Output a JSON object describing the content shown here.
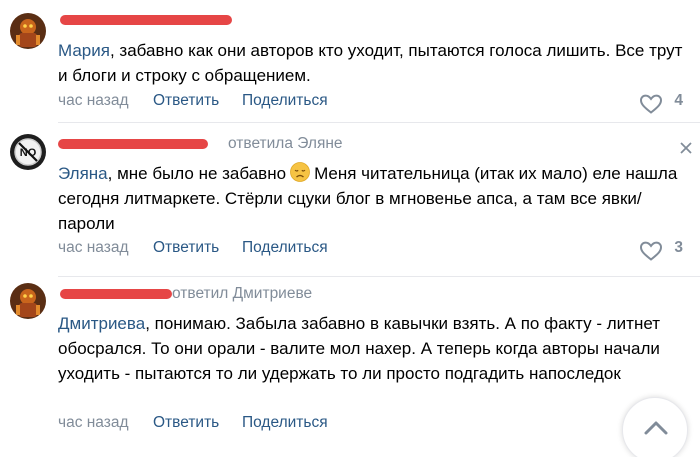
{
  "comments": [
    {
      "author_redacted": true,
      "reply_to": "",
      "mention": "Мария",
      "text": ", забавно как они авторов кто уходит, пытаются голоса лишить. Все трут и блоги и строку с обращением.",
      "time": "час назад",
      "reply_label": "Ответить",
      "share_label": "Поделиться",
      "likes": "4",
      "avatar_icon": "avatar-icon"
    },
    {
      "author_redacted": true,
      "reply_to": "ответила Эляне",
      "mention": "Эляна",
      "text_before_emoji": ", мне было не забавно",
      "emoji": "disappointed-face-emoji",
      "text_after_emoji": "Меня читательница (итак их мало) еле нашла сегодня литмаркете. Стёрли сцуки блог в мгновенье апса, а там все явки/пароли",
      "time": "час назад",
      "reply_label": "Ответить",
      "share_label": "Поделиться",
      "likes": "3",
      "avatar_icon": "no-sign-avatar-icon"
    },
    {
      "author_redacted": true,
      "reply_to": "ответил Дмитриеве",
      "mention": "Дмитриева",
      "text": ", понимаю. Забыла забавно в кавычки взять. А по факту - литнет обосрался. То они орали - валите мол нахер. А теперь когда авторы начали уходить - пытаются то ли удержать то ли просто подгадить напоследок",
      "time": "час назад",
      "reply_label": "Ответить",
      "share_label": "Поделиться",
      "likes": "",
      "avatar_icon": "avatar-icon"
    }
  ],
  "colors": {
    "link": "#2a5885",
    "secondary": "#818c99",
    "redaction": "#e64646",
    "divider": "#e7e8ec"
  },
  "icons": {
    "like": "heart-icon",
    "close": "close-icon",
    "scroll_top": "chevron-up-icon"
  }
}
